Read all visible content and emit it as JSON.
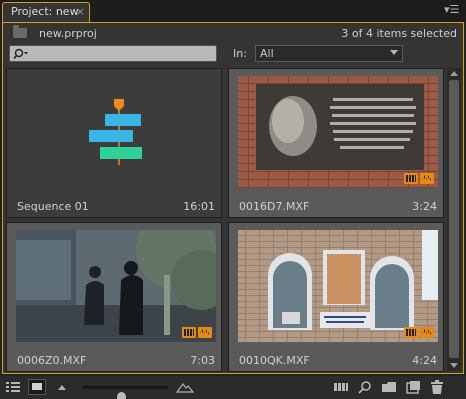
{
  "tab": {
    "title": "Project: new",
    "close_glyph": "×"
  },
  "panel_menu_glyph": "▾☰",
  "project": {
    "name": "new.prproj",
    "selection_status": "3 of 4 items selected"
  },
  "search": {
    "value": "",
    "placeholder": ""
  },
  "filter": {
    "label": "In:",
    "selected": "All"
  },
  "items": [
    {
      "name": "Sequence 01",
      "duration": "16:01",
      "type": "sequence"
    },
    {
      "name": "0016D7.MXF",
      "duration": "3:24",
      "type": "clip"
    },
    {
      "name": "0006Z0.MXF",
      "duration": "7:03",
      "type": "clip"
    },
    {
      "name": "0010QK.MXF",
      "duration": "4:24",
      "type": "clip"
    }
  ],
  "zoom_level": 0.45,
  "colors": {
    "accent": "#d4a017",
    "badge": "#e88a10",
    "sequence_cyan": "#38b6e6",
    "sequence_green": "#2fd19a",
    "sequence_orange": "#f08a1a"
  },
  "icons": [
    "folder-icon",
    "search-icon",
    "list-view-icon",
    "icon-view-icon",
    "zoom-out-icon",
    "zoom-in-icon",
    "automate-to-sequence-icon",
    "find-icon",
    "new-bin-icon",
    "new-item-icon",
    "delete-icon"
  ]
}
